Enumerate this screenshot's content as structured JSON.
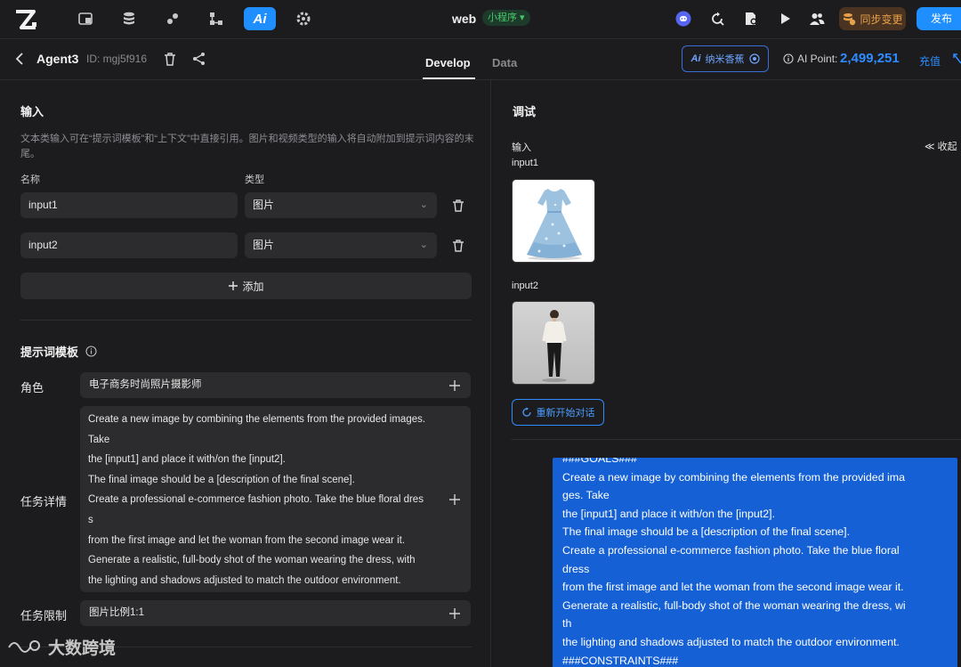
{
  "topbar": {
    "app_title": "web",
    "mini_badge": "小程序 ▾",
    "nav_icons": [
      "windows-icon",
      "database-icon",
      "plugin-icon",
      "workflow-icon",
      "ai-icon",
      "settings-icon"
    ],
    "ai_label": "Ai",
    "sync_label": "同步变更",
    "publish_label": "发布"
  },
  "subbar": {
    "agent_name": "Agent3",
    "agent_id": "ID: mgj5f916",
    "tabs": [
      {
        "label": "Develop",
        "active": true
      },
      {
        "label": "Data",
        "active": false
      }
    ],
    "model_label": "纳米香蕉",
    "ai_point_label": "AI Point:",
    "ai_point_value": "2,499,251",
    "recharge_label": "充值"
  },
  "left": {
    "input_title": "输入",
    "input_desc": "文本类输入可在“提示词模板”和“上下文”中直接引用。图片和视频类型的输入将自动附加到提示词内容的末尾。",
    "name_header": "名称",
    "type_header": "类型",
    "inputs": [
      {
        "name": "input1",
        "type": "图片"
      },
      {
        "name": "input2",
        "type": "图片"
      }
    ],
    "add_label": "添加",
    "prompt_title": "提示词模板",
    "role_label": "角色",
    "role_value": "电子商务时尚照片摄影师",
    "task_label": "任务详情",
    "task_lines": [
      "Create a new image by combining the elements from the provided images.",
      "Take",
      "the [input1]  and place it with/on the [input2].",
      "The final image should be a [description of the final scene].",
      "Create a professional e-commerce fashion photo. Take the blue floral dres",
      "s",
      "from the first image and let the woman from the second image wear it.",
      "Generate a realistic, full-body shot of the woman wearing the dress, with",
      "the lighting and shadows adjusted to match the outdoor environment."
    ],
    "limit_label": "任务限制",
    "limit_value": "图片比例1:1"
  },
  "right": {
    "debug_title": "调试",
    "input_label": "输入",
    "collapse_label": "收起",
    "input1_label": "input1",
    "input2_label": "input2",
    "restart_label": "重新开始对话",
    "bubble_lines": [
      "###GOALS###",
      "Create a new image by combining the elements from the provided ima",
      "ges. Take",
      "the [input1]  and place it with/on the [input2].",
      "The final image should be a [description of the final scene].",
      "Create a professional e-commerce fashion photo. Take the blue floral",
      "dress",
      "from the first image and let the woman from the second image wear it.",
      "Generate a realistic, full-body shot of the woman wearing the dress, wi",
      "th",
      "the lighting and shadows adjusted to match the outdoor environment.",
      "###CONSTRAINTS###"
    ]
  },
  "watermark": "大数跨境"
}
